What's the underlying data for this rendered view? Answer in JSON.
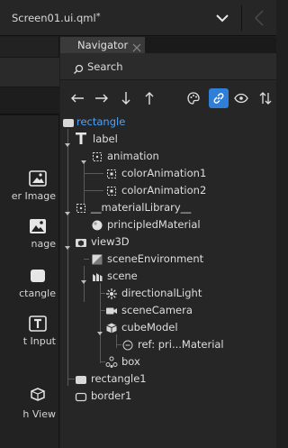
{
  "topbar": {
    "filename": "Screen01.ui.qml",
    "modified_marker": "*"
  },
  "left_panel": {
    "items": [
      {
        "label": "er Image",
        "icon": "border-image-icon"
      },
      {
        "label": "nage",
        "icon": "image-icon"
      },
      {
        "label": "ctangle",
        "icon": "rectangle-icon"
      },
      {
        "label": "t Input",
        "icon": "text-input-icon"
      },
      {
        "label": "h View",
        "icon": "view3d-icon"
      }
    ]
  },
  "navigator": {
    "tab_label": "Navigator",
    "search_placeholder": "Search",
    "toolbar": [
      "arrow-left-icon",
      "arrow-right-icon",
      "arrow-down-icon",
      "arrow-up-icon",
      "palette-icon",
      "link-icon",
      "eye-icon",
      "sort-icon"
    ],
    "tree": [
      {
        "label": "rectangle",
        "icon": "rectangle-icon",
        "selected": true
      },
      {
        "label": "label",
        "icon": "text-icon"
      },
      {
        "label": "animation",
        "icon": "animation-icon"
      },
      {
        "label": "colorAnimation1",
        "icon": "color-animation-icon"
      },
      {
        "label": "colorAnimation2",
        "icon": "color-animation-icon"
      },
      {
        "label": "__materialLibrary__",
        "icon": "material-library-icon"
      },
      {
        "label": "principledMaterial",
        "icon": "material-icon"
      },
      {
        "label": "view3D",
        "icon": "view3d-icon"
      },
      {
        "label": "sceneEnvironment",
        "icon": "scene-environment-icon"
      },
      {
        "label": "scene",
        "icon": "scene-icon"
      },
      {
        "label": "directionalLight",
        "icon": "light-icon"
      },
      {
        "label": "sceneCamera",
        "icon": "camera-icon"
      },
      {
        "label": "cubeModel",
        "icon": "model-icon"
      },
      {
        "label": "ref: pri...Material",
        "icon": "reference-icon"
      },
      {
        "label": "box",
        "icon": "node-icon"
      },
      {
        "label": "rectangle1",
        "icon": "rectangle-icon"
      },
      {
        "label": "border1",
        "icon": "border-icon"
      }
    ]
  },
  "colors": {
    "accent": "#2f7ed8",
    "selected_text": "#4aa3ff",
    "background": "#262626"
  }
}
